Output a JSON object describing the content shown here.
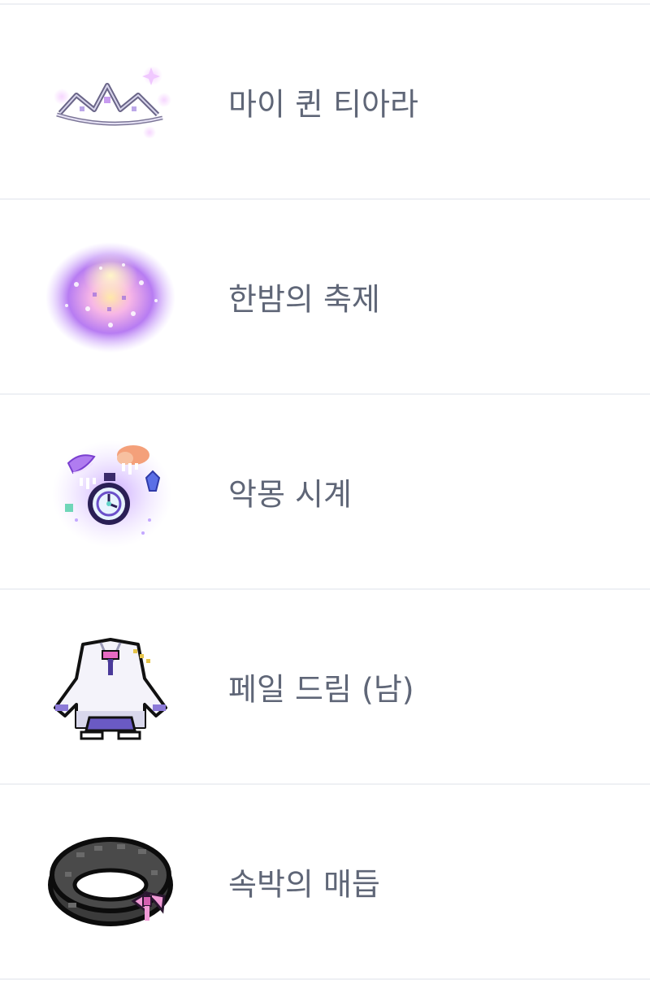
{
  "items": [
    {
      "name": "마이 퀸 티아라",
      "icon": "tiara-icon"
    },
    {
      "name": "한밤의 축제",
      "icon": "festival-effect-icon"
    },
    {
      "name": "악몽 시계",
      "icon": "nightmare-clock-icon"
    },
    {
      "name": "페일 드림 (남)",
      "icon": "pale-dream-outfit-icon"
    },
    {
      "name": "속박의 매듭",
      "icon": "bondage-knot-collar-icon"
    }
  ],
  "colors": {
    "text": "#5f6677",
    "divider": "#eef0f4",
    "background": "#ffffff"
  }
}
